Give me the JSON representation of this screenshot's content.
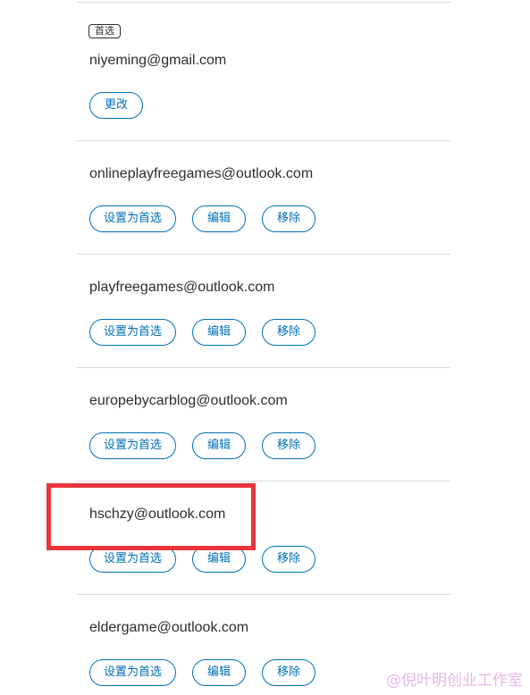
{
  "emails": [
    {
      "address": "niyeming@gmail.com",
      "primary_badge": "首选",
      "change_label": "更改"
    },
    {
      "address": "onlineplayfreegames@outlook.com",
      "set_primary_label": "设置为首选",
      "edit_label": "编辑",
      "remove_label": "移除"
    },
    {
      "address": "playfreegames@outlook.com",
      "set_primary_label": "设置为首选",
      "edit_label": "编辑",
      "remove_label": "移除"
    },
    {
      "address": "europebycarblog@outlook.com",
      "set_primary_label": "设置为首选",
      "edit_label": "编辑",
      "remove_label": "移除"
    },
    {
      "address": "hschzy@outlook.com",
      "set_primary_label": "设置为首选",
      "edit_label": "编辑",
      "remove_label": "移除"
    },
    {
      "address": "eldergame@outlook.com",
      "set_primary_label": "设置为首选",
      "edit_label": "编辑",
      "remove_label": "移除"
    }
  ],
  "annotation": {
    "highlight_color": "#e8353b"
  },
  "watermark": "@倪叶明创业工作室",
  "colors": {
    "accent": "#0070ba",
    "text": "#2c2e2f",
    "divider": "#d9d9d9"
  }
}
